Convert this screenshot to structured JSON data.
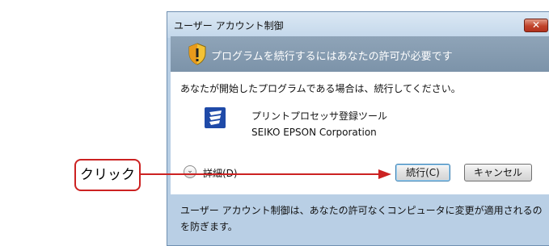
{
  "dialog": {
    "title": "ユーザー アカウント制御",
    "close_label": "✕",
    "header": "プログラムを続行するにはあなたの許可が必要です",
    "instruction": "あなたが開始したプログラムである場合は、続行してください。",
    "program": {
      "name": "プリントプロセッサ登録ツール",
      "publisher": "SEIKO EPSON Corporation",
      "icon": "epson-app-icon"
    },
    "details_label": "詳細(D)",
    "continue_label": "続行(C)",
    "cancel_label": "キャンセル",
    "footer": "ユーザー アカウント制御は、あなたの許可なくコンピュータに変更が適用されるのを防ぎます。"
  },
  "annotation": {
    "callout_label": "クリック",
    "color": "#cc2222"
  },
  "colors": {
    "header_band": "#8fa4b8",
    "frame": "#b9cfe5",
    "close_button": "#c0432b"
  }
}
